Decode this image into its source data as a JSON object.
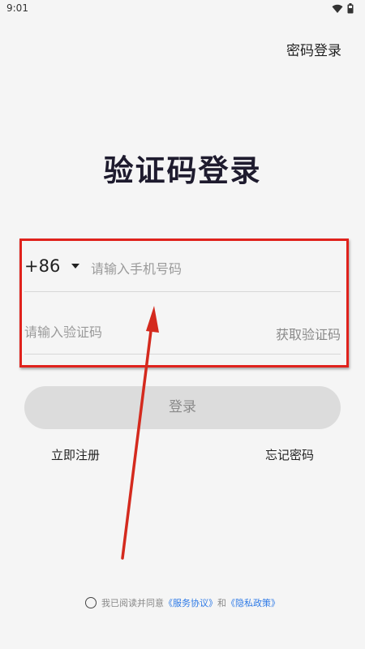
{
  "status_bar": {
    "time": "9:01"
  },
  "header": {
    "switch_mode_label": "密码登录"
  },
  "page": {
    "title": "验证码登录"
  },
  "form": {
    "country_code": "+86",
    "phone_placeholder": "请输入手机号码",
    "code_placeholder": "请输入验证码",
    "get_code_label": "获取验证码",
    "login_label": "登录"
  },
  "links": {
    "register": "立即注册",
    "forgot_password": "忘记密码"
  },
  "agreement": {
    "prefix": "我已阅读并同意",
    "service_link": "《服务协议》",
    "connector": "和",
    "privacy_link": "《隐私政策》"
  },
  "colors": {
    "annotation": "#e0221c",
    "link": "#2e7ae6",
    "background": "#f5f5f5"
  }
}
